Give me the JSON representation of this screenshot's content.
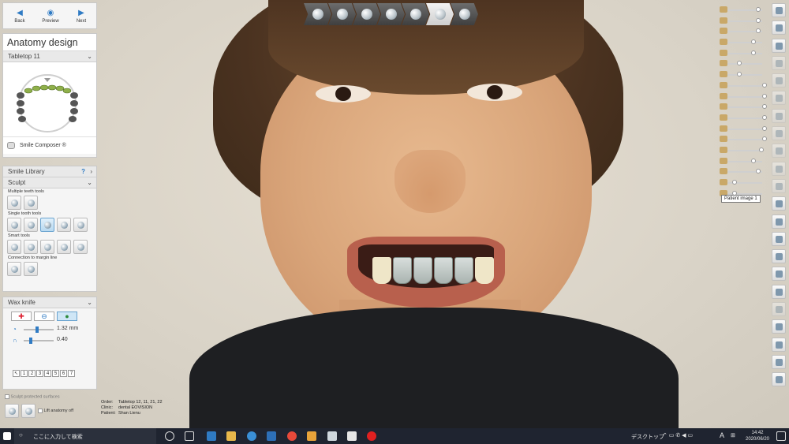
{
  "app": {
    "title": "Anatomy design",
    "nav": {
      "back": "Back",
      "preview": "Preview",
      "next": "Next"
    }
  },
  "anatomy": {
    "restoration_label": "Tabletop 11",
    "smile_composer": "Smile Composer ®",
    "smile_library": "Smile Library",
    "smile_library_help": "?"
  },
  "sculpt": {
    "title": "Sculpt",
    "multiple_label": "Multiple teeth tools",
    "single_label": "Single tooth tools",
    "smart_label": "Smart tools",
    "connection_label": "Connection to margin line"
  },
  "wax_knife": {
    "title": "Wax knife",
    "size_value": "1.32 mm",
    "size_fraction": 0.4,
    "strength_value": "0.40",
    "strength_fraction": 0.18,
    "presets": [
      "1",
      "2",
      "3",
      "4",
      "5",
      "6",
      "7"
    ],
    "protect_label": "Sculpt protected surfaces",
    "lift_label": "Lift anatomy off"
  },
  "info": {
    "order_label": "Order:",
    "order_value": "Tabletop 12, 11, 21, 22",
    "clinic_label": "Clinic:",
    "clinic_value": "dental EOVISION",
    "patient_label": "Patient:",
    "patient_value": "Shan Lienu"
  },
  "tooltip": {
    "patient_image": "Patient image 1"
  },
  "colors": {
    "accent": "#2f7bc4",
    "panel": "#f5f5f5",
    "taskbar": "#1f2430"
  },
  "taskbar": {
    "search_placeholder": "ここに入力して検索",
    "desktop": "デスクトップ",
    "ime": "A",
    "time": "14:42",
    "date": "2020/06/20"
  }
}
